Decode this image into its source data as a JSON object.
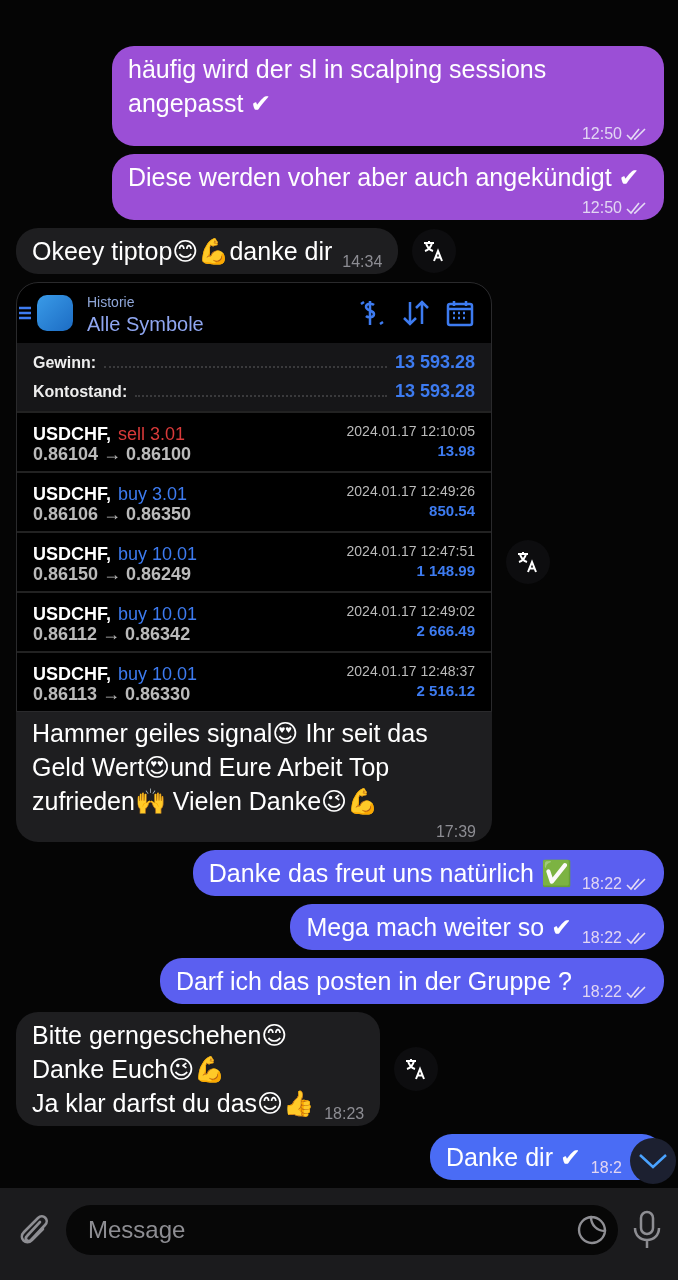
{
  "messages": [
    {
      "kind": "outgoing",
      "color": "#9b4fd6",
      "text": "häufig wird der sl in scalping sessions angepasst ✔︎",
      "time": "12:50",
      "read": true
    },
    {
      "kind": "outgoing",
      "color": "#9b4fd6",
      "text": "Diese werden voher aber auch angekündigt ✔︎",
      "time": "12:50",
      "read": true
    },
    {
      "kind": "incoming",
      "text": "Okeey tiptop😊💪danke dir",
      "time": "14:34",
      "translate": true
    },
    {
      "kind": "trade_history",
      "history": {
        "subtitle": "Historie",
        "title": "Alle Symbole",
        "summary": [
          {
            "label": "Gewinn:",
            "value": "13 593.28"
          },
          {
            "label": "Kontostand:",
            "value": "13 593.28"
          }
        ],
        "trades": [
          {
            "symbol": "USDCHF,",
            "color": "#d83a3a",
            "order": "sell 3.01",
            "prices": "0.86104 → 0.86100",
            "date": "2024.01.17 12:10:05",
            "profit": "13.98"
          },
          {
            "symbol": "USDCHF,",
            "color": "#3d7bf0",
            "order": "buy 3.01",
            "prices": "0.86106 → 0.86350",
            "date": "2024.01.17 12:49:26",
            "profit": "850.54"
          },
          {
            "symbol": "USDCHF,",
            "color": "#3d7bf0",
            "order": "buy 10.01",
            "prices": "0.86150 → 0.86249",
            "date": "2024.01.17 12:47:51",
            "profit": "1 148.99"
          },
          {
            "symbol": "USDCHF,",
            "color": "#3d7bf0",
            "order": "buy 10.01",
            "prices": "0.86112 → 0.86342",
            "date": "2024.01.17 12:49:02",
            "profit": "2 666.49"
          },
          {
            "symbol": "USDCHF,",
            "color": "#3d7bf0",
            "order": "buy 10.01",
            "prices": "0.86113 → 0.86330",
            "date": "2024.01.17 12:48:37",
            "profit": "2 516.12"
          }
        ]
      },
      "text": "Hammer geiles signal😍 Ihr seit das Geld Wert😍und Eure Arbeit Top zufrieden🙌 Vielen Danke😉💪",
      "time": "17:39",
      "translate": true
    },
    {
      "kind": "outgoing",
      "color": "#5b5ff0",
      "text": "Danke das freut uns natürlich ✅",
      "time": "18:22",
      "read": true
    },
    {
      "kind": "outgoing",
      "color": "#5b5ff0",
      "text": "Mega mach weiter so ✔︎",
      "time": "18:22",
      "read": true
    },
    {
      "kind": "outgoing",
      "color": "#5b5ff0",
      "text": "Darf ich das posten in der Gruppe ?",
      "time": "18:22",
      "read": true
    },
    {
      "kind": "incoming",
      "text": "Bitte gerngeschehen😊\nDanke Euch😉💪\nJa klar darfst du das😊👍",
      "time": "18:23",
      "translate": true
    },
    {
      "kind": "outgoing",
      "color": "#4a6cf5",
      "text": "Danke dir ✔︎",
      "time": "18:2",
      "read": false
    }
  ],
  "composer": {
    "placeholder": "Message"
  }
}
